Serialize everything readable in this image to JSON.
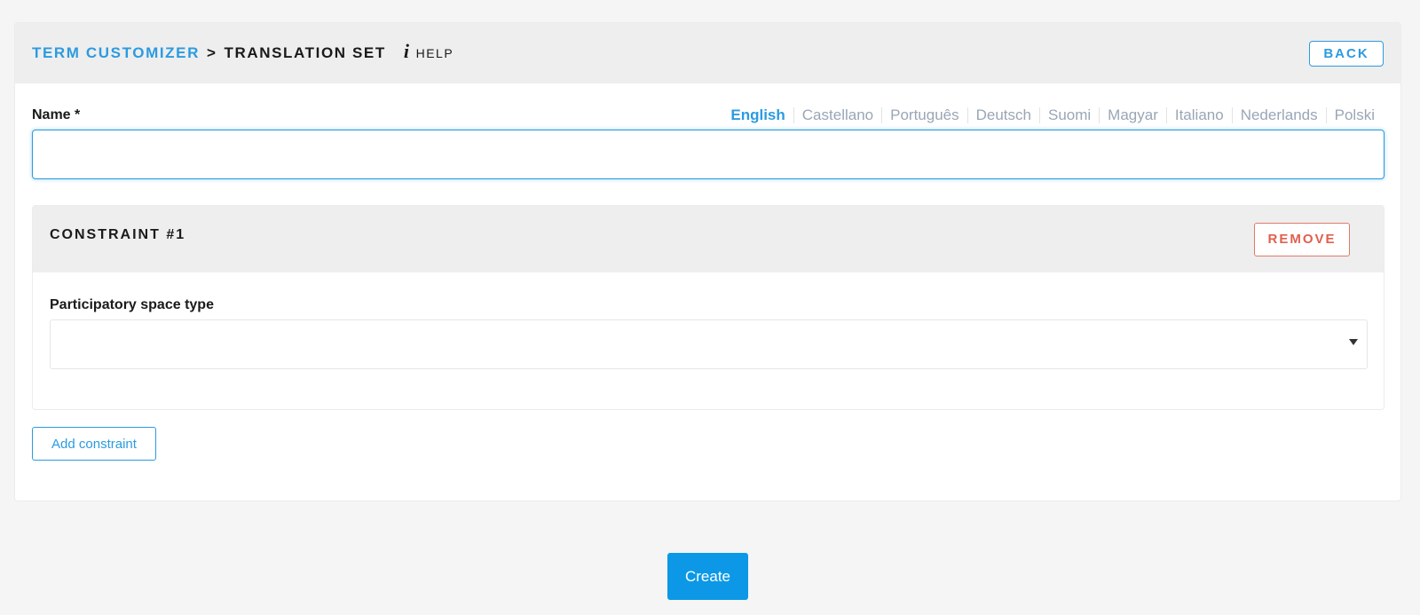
{
  "header": {
    "breadcrumb_root": "TERM CUSTOMIZER",
    "breadcrumb_separator": ">",
    "breadcrumb_current": "TRANSLATION SET",
    "help_icon_glyph": "i",
    "help_label": "HELP",
    "back_label": "BACK"
  },
  "name_field": {
    "label": "Name *",
    "value": "",
    "placeholder": ""
  },
  "languages": {
    "active": "English",
    "items": [
      "English",
      "Castellano",
      "Português",
      "Deutsch",
      "Suomi",
      "Magyar",
      "Italiano",
      "Nederlands",
      "Polski"
    ]
  },
  "constraint": {
    "title": "CONSTRAINT #1",
    "remove_label": "REMOVE",
    "space_type_label": "Participatory space type",
    "space_type_value": ""
  },
  "actions": {
    "add_constraint_label": "Add constraint",
    "create_label": "Create"
  },
  "colors": {
    "accent": "#2b9be0",
    "create_button": "#0c98e6",
    "danger": "#e0604e",
    "header_bg": "#eeeeee",
    "page_bg": "#f5f5f5",
    "inactive_lang": "#9aa6b6"
  }
}
